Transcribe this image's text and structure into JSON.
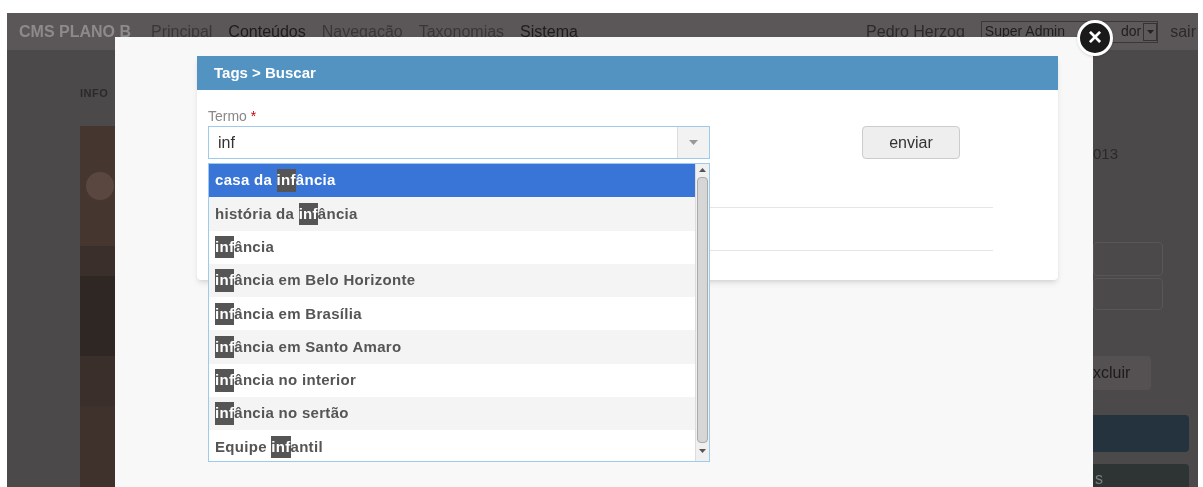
{
  "navbar": {
    "brand": "CMS PLANO B",
    "items": [
      {
        "label": "Principal",
        "selected": false
      },
      {
        "label": "Conteúdos",
        "selected": true
      },
      {
        "label": "Navegação",
        "selected": false
      },
      {
        "label": "Taxonomias",
        "selected": false
      },
      {
        "label": "Sistema",
        "selected": true
      }
    ],
    "user": "Pedro Herzog",
    "role_select": {
      "text_start": "Super Admin",
      "text_end": "dor"
    },
    "logout": "sair"
  },
  "background": {
    "section_label": "INFO",
    "date_fragment": "013",
    "button_fragment": "xcluir",
    "bar_fragment": "s"
  },
  "modal": {
    "close": "×",
    "panel_title": "Tags > Buscar",
    "field": {
      "label": "Termo",
      "required_mark": "*",
      "value": "inf"
    },
    "submit": "enviar",
    "suggestions": [
      {
        "before": "casa da ",
        "match": "inf",
        "after": "ância",
        "selected": true
      },
      {
        "before": "história da ",
        "match": "inf",
        "after": "ância",
        "selected": false
      },
      {
        "match": "inf",
        "after": "ância",
        "selected": false
      },
      {
        "match": "inf",
        "after": "ância em Belo Horizonte",
        "selected": false
      },
      {
        "match": "inf",
        "after": "ância em Brasília",
        "selected": false
      },
      {
        "match": "inf",
        "after": "ância em Santo Amaro",
        "selected": false
      },
      {
        "match": "inf",
        "after": "ância no interior",
        "selected": false
      },
      {
        "match": "inf",
        "after": "ância no sertão",
        "selected": false
      },
      {
        "before": "Equipe ",
        "match": "inf",
        "after": "antil",
        "selected": false
      }
    ]
  }
}
